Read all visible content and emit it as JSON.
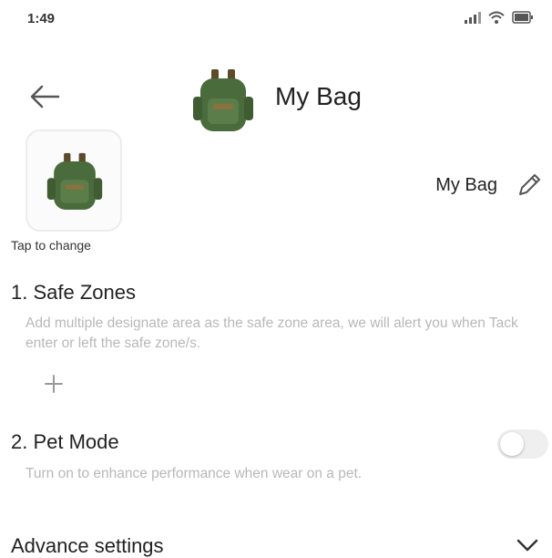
{
  "status_bar": {
    "time": "1:49"
  },
  "header": {
    "title": "My Bag"
  },
  "avatar": {
    "tap_label": "Tap to change"
  },
  "device": {
    "name": "My Bag"
  },
  "safe_zones": {
    "title": "1. Safe Zones",
    "description": "Add multiple designate area as the safe zone area, we will alert you when Tack enter or left the safe zone/s."
  },
  "pet_mode": {
    "title": "2. Pet Mode",
    "description": "Turn on to enhance performance when wear on a pet.",
    "enabled": false
  },
  "advance": {
    "label": "Advance settings"
  },
  "colors": {
    "bag_body": "#4a6b3c",
    "bag_accent": "#8a7240",
    "hint_text": "#b8b8b8",
    "toggle_off": "#efefef"
  }
}
